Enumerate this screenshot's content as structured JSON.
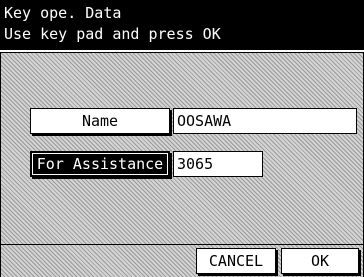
{
  "header": {
    "line1": "Key ope. Data",
    "line2": "Use key pad and press OK"
  },
  "form": {
    "name_label": "Name",
    "name_value": "OOSAWA",
    "assist_label": "For Assistance",
    "assist_value": "3065"
  },
  "footer": {
    "cancel_label": "CANCEL",
    "ok_label": "OK"
  }
}
